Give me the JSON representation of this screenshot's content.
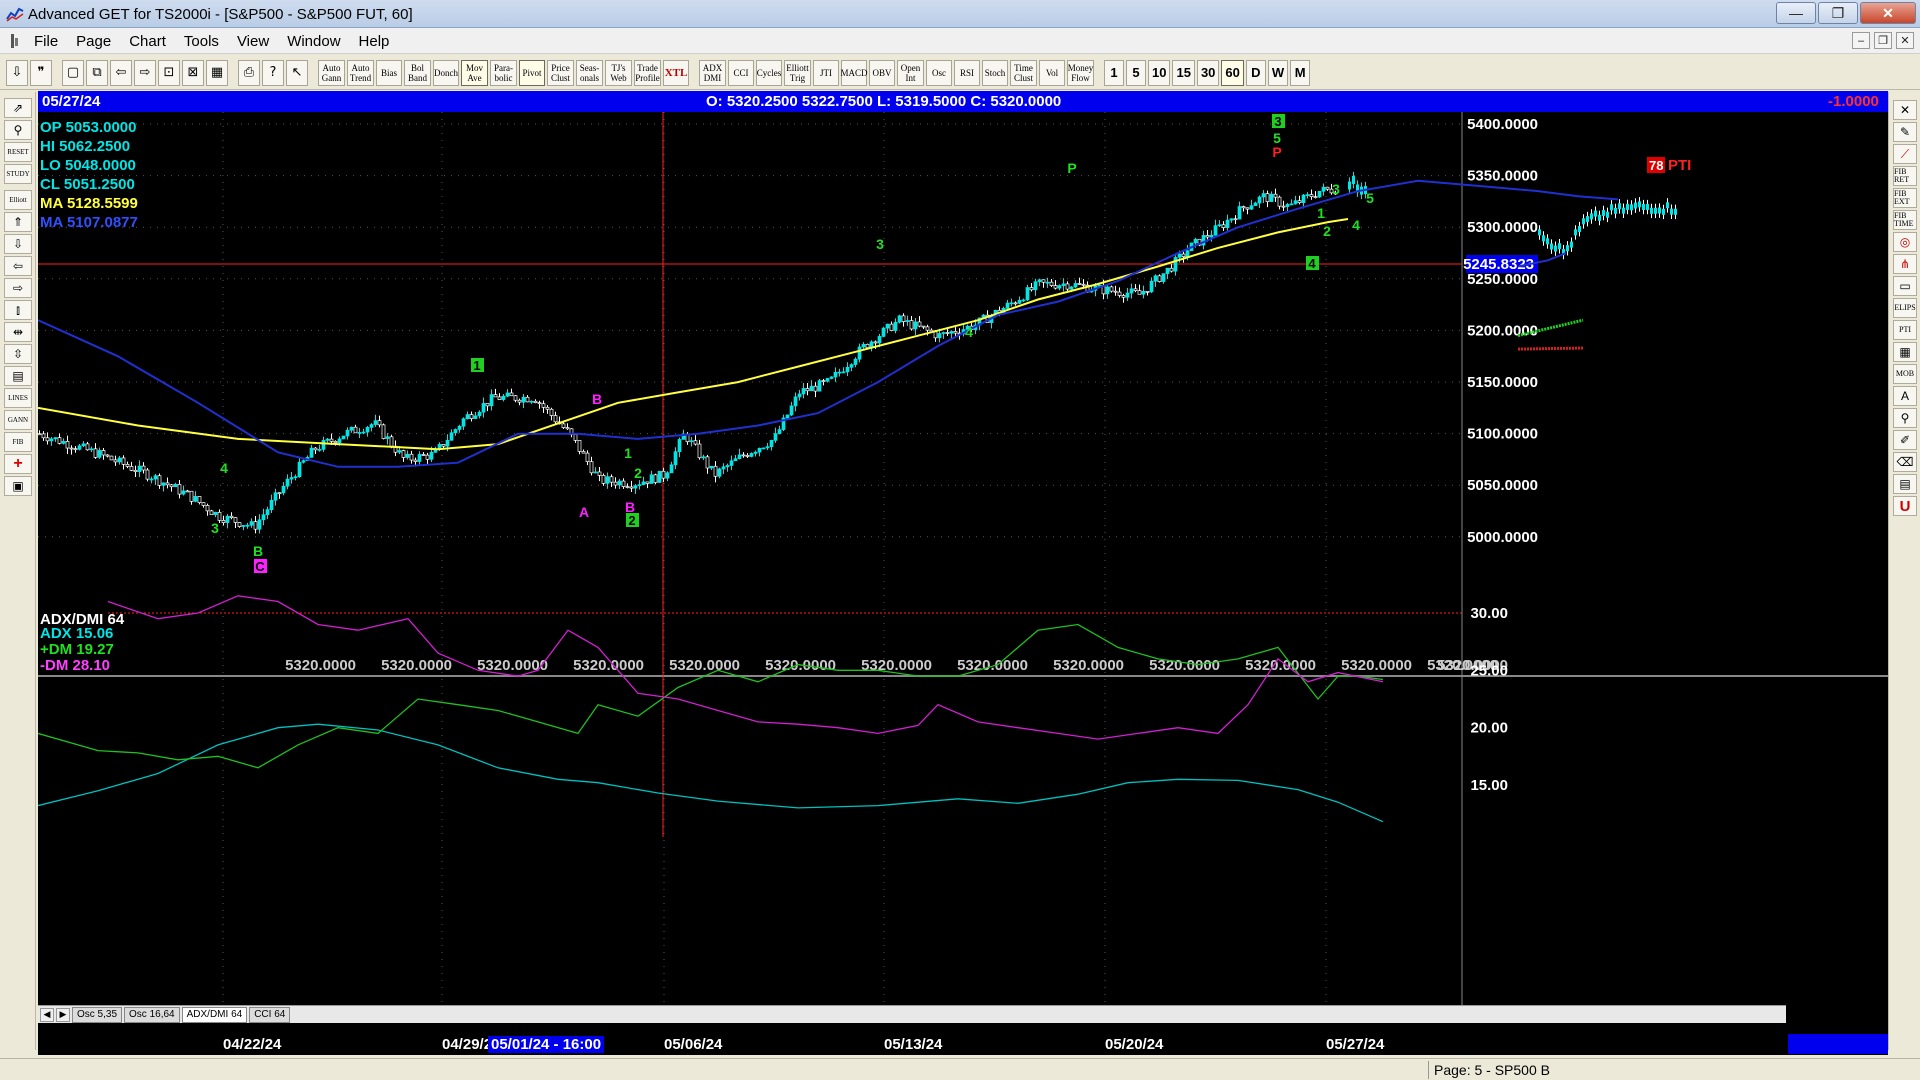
{
  "window": {
    "title": "Advanced GET for TS2000i - [S&P500 - S&P500 FUT, 60]",
    "minimize": "—",
    "restore": "❐",
    "close": "✕"
  },
  "menu": {
    "items": [
      "File",
      "Page",
      "Chart",
      "Tools",
      "View",
      "Window",
      "Help"
    ],
    "mdi_min": "–",
    "mdi_restore": "❐",
    "mdi_close": "✕"
  },
  "toolbar": {
    "studies": [
      "Auto Gann",
      "Auto Trend",
      "Bias",
      "Bol Band",
      "Donch",
      "Mov Ave",
      "Para- bolic",
      "Pivot",
      "Price Clust",
      "Seas- onals",
      "TJ's Web",
      "Trade Profile",
      "XTL",
      "ADX DMI",
      "CCI",
      "Cycles",
      "Elliott Trig",
      "JTI",
      "MACD",
      "OBV",
      "Open Int",
      "Osc",
      "RSI",
      "Stoch",
      "Time Clust",
      "Vol",
      "Money Flow"
    ],
    "periods": [
      "1",
      "5",
      "10",
      "15",
      "30",
      "60",
      "D",
      "W",
      "M"
    ]
  },
  "left_toolbar": {
    "labels": [
      "RESET",
      "STUDY",
      "Elliott",
      "LINES",
      "GANN",
      "FIB"
    ]
  },
  "right_toolbar": {
    "labels": [
      "FIB RET",
      "FIB EXT",
      "FIB TIME",
      "ELIPS",
      "PTI",
      "MOB",
      "A",
      "U"
    ]
  },
  "infobar": {
    "date": "05/27/24",
    "ohlc": "O:  5320.2500       5322.7500    L:  5319.5000    C:  5320.0000",
    "change": "-1.0000"
  },
  "main_panel": {
    "legend": [
      {
        "label": "OP  5053.0000",
        "color": "#00e5e5"
      },
      {
        "label": "HI   5062.2500",
        "color": "#00e5e5"
      },
      {
        "label": "LO  5048.0000",
        "color": "#00e5e5"
      },
      {
        "label": "CL  5051.2500",
        "color": "#00e5e5"
      },
      {
        "label": "MA  5128.5599",
        "color": "#ffff40"
      },
      {
        "label": "MA  5107.0877",
        "color": "#3050ff"
      }
    ],
    "y_ticks": [
      "5400.0000",
      "5350.0000",
      "5300.0000",
      "5250.0000",
      "5200.0000",
      "5150.0000",
      "5100.0000",
      "5050.0000",
      "5000.0000"
    ],
    "cursor_price": "5245.8323",
    "bottom_values": [
      "5320.0000",
      "5320.0000",
      "5320.0000",
      "5320.0000",
      "5320.0000",
      "5320.0000",
      "5320.0000",
      "5320.0000",
      "5320.0000",
      "5320.0000",
      "5320.0000",
      "5320.0000",
      "5320.0000",
      "5320.0000"
    ],
    "pti_value": "78",
    "pti_label": "PTI",
    "wave_labels": [
      "4",
      "3",
      "B",
      "C",
      "1",
      "B",
      "A",
      "1",
      "2",
      "B",
      "2",
      "3",
      "4",
      "P",
      "3",
      "5",
      "P",
      "1",
      "2",
      "4",
      "3",
      "4",
      "5"
    ]
  },
  "adx_panel": {
    "title": "ADX/DMI 64",
    "adx": "ADX 15.06",
    "plus_dm": "+DM 19.27",
    "minus_dm": "-DM 28.10",
    "y_ticks": [
      "30.00",
      "25.00",
      "20.00",
      "15.00"
    ]
  },
  "tabs": {
    "items": [
      "Osc 5,35",
      "Osc 16,64",
      "ADX/DMI 64",
      "CCI 64"
    ],
    "active": "ADX/DMI 64"
  },
  "dates": {
    "labels": [
      "04/22/24",
      "04/29/2",
      "05/06/24",
      "05/13/24",
      "05/20/24",
      "05/27/24"
    ],
    "cursor": "05/01/24 - 16:00"
  },
  "status": {
    "page": "Page: 5 - SP500 B"
  },
  "colors": {
    "bull_candle": "#00e5e5",
    "ma_yellow": "#ffff40",
    "ma_blue": "#2030d0",
    "adx": "#00c0c0",
    "plus_dm": "#20c020",
    "minus_dm": "#d020d0",
    "wave_green": "#20e020",
    "wave_magenta": "#ff20ff"
  }
}
